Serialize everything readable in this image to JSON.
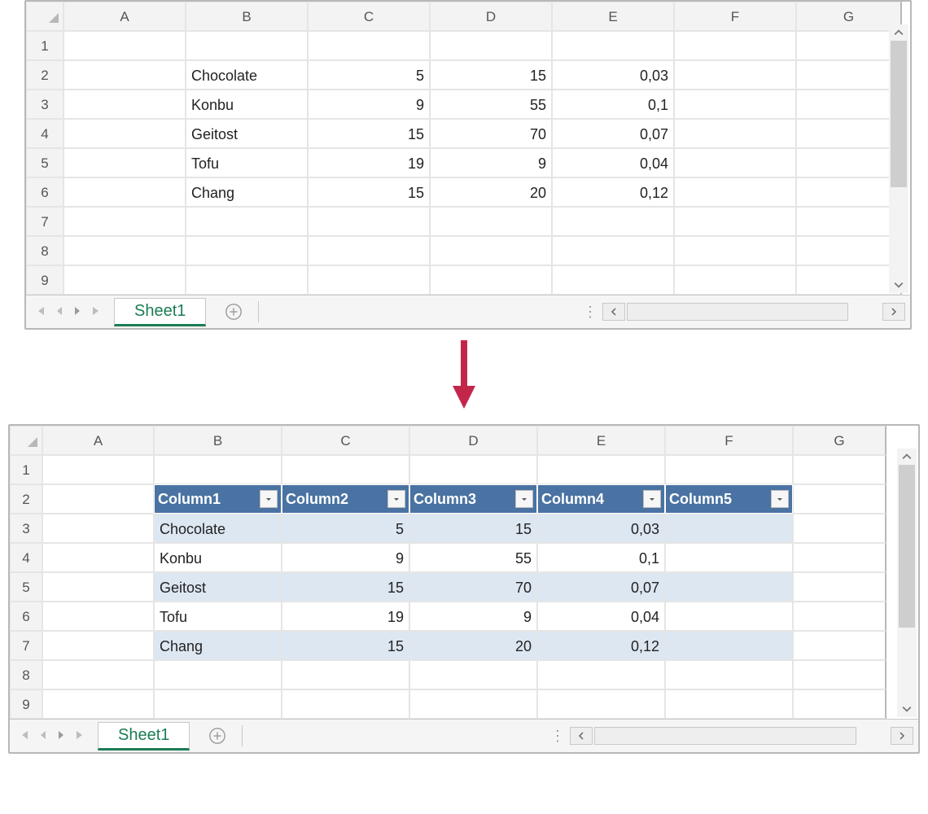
{
  "columns": [
    "A",
    "B",
    "C",
    "D",
    "E",
    "F",
    "G"
  ],
  "rows_plain": 9,
  "rows_table": 9,
  "sheetTab": "Sheet1",
  "plain": {
    "2": {
      "B": "Chocolate",
      "C": "5",
      "D": "15",
      "E": "0,03"
    },
    "3": {
      "B": "Konbu",
      "C": "9",
      "D": "55",
      "E": "0,1"
    },
    "4": {
      "B": "Geitost",
      "C": "15",
      "D": "70",
      "E": "0,07"
    },
    "5": {
      "B": "Tofu",
      "C": "19",
      "D": "9",
      "E": "0,04"
    },
    "6": {
      "B": "Chang",
      "C": "15",
      "D": "20",
      "E": "0,12"
    }
  },
  "tableHeaders": [
    "Column1",
    "Column2",
    "Column3",
    "Column4",
    "Column5"
  ],
  "tableRows": [
    {
      "r": 3,
      "band": true,
      "B": "Chocolate",
      "C": "5",
      "D": "15",
      "E": "0,03",
      "F": ""
    },
    {
      "r": 4,
      "band": false,
      "B": "Konbu",
      "C": "9",
      "D": "55",
      "E": "0,1",
      "F": ""
    },
    {
      "r": 5,
      "band": true,
      "B": "Geitost",
      "C": "15",
      "D": "70",
      "E": "0,07",
      "F": ""
    },
    {
      "r": 6,
      "band": false,
      "B": "Tofu",
      "C": "19",
      "D": "9",
      "E": "0,04",
      "F": ""
    },
    {
      "r": 7,
      "band": true,
      "B": "Chang",
      "C": "15",
      "D": "20",
      "E": "0,12",
      "F": ""
    }
  ]
}
